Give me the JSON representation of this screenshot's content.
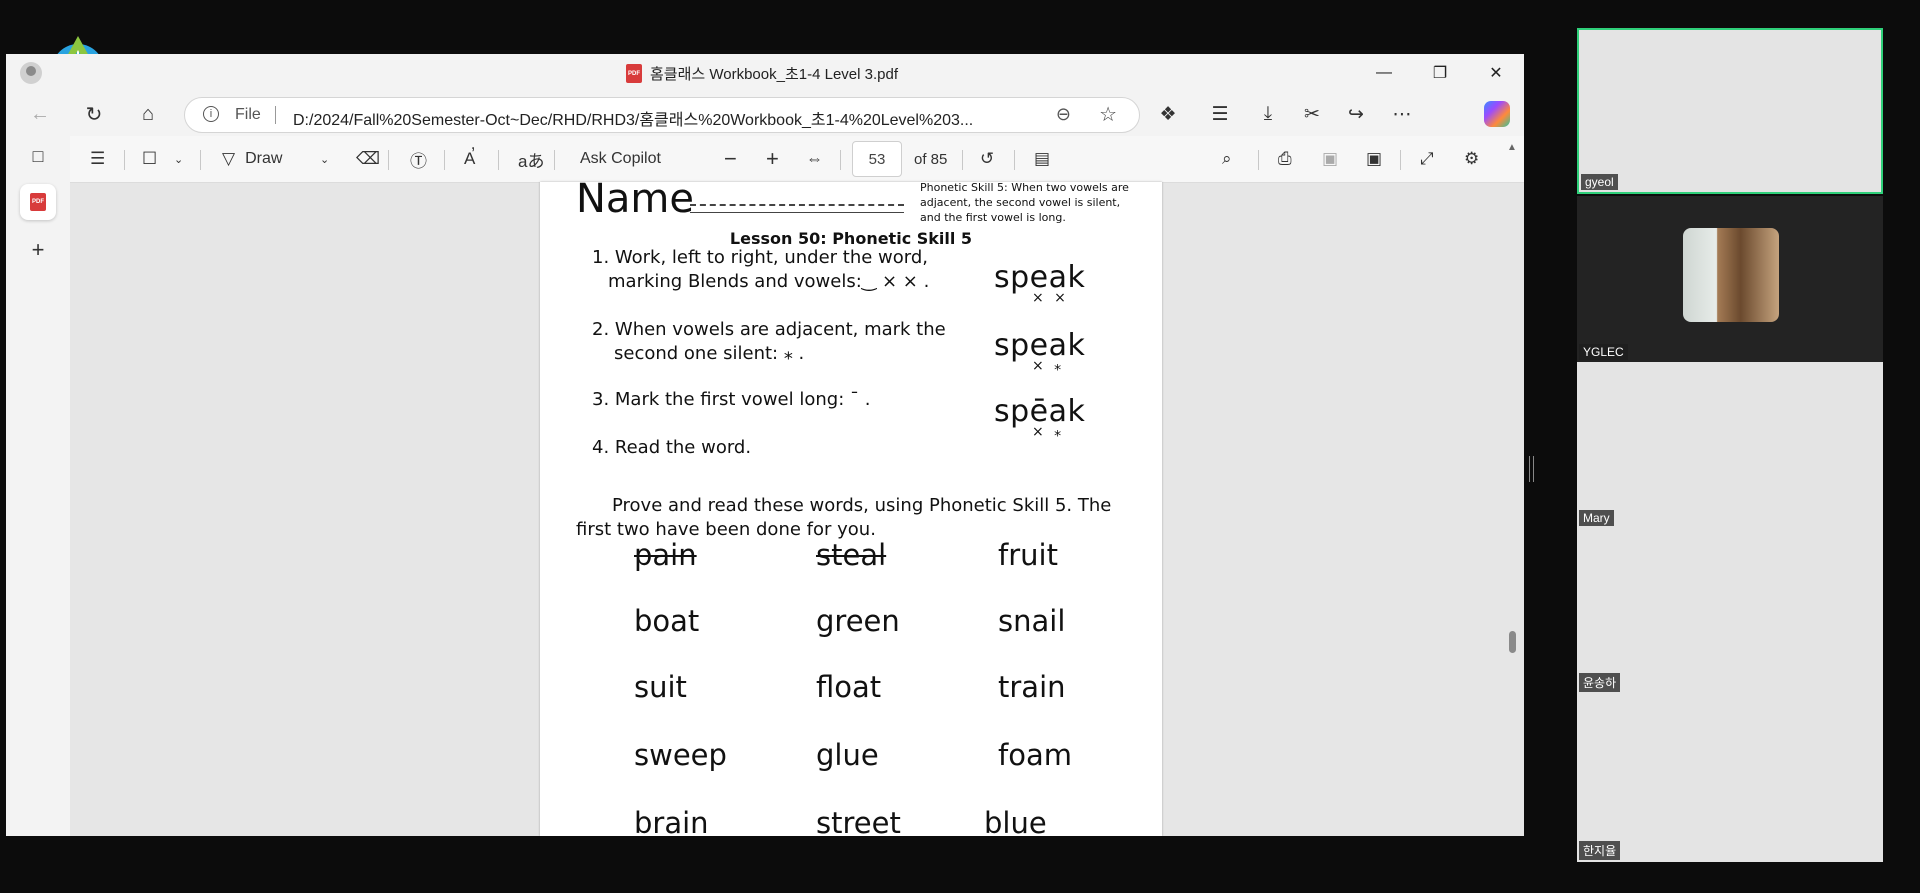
{
  "window": {
    "title": "홈클래스 Workbook_초1-4 Level 3.pdf",
    "pdf_icon_label": "PDF"
  },
  "address": {
    "scheme_label": "File",
    "url": "D:/2024/Fall%20Semester-Oct~Dec/RHD/RHD3/홈클래스%20Workbook_초1-4%20Level%203..."
  },
  "pdf_toolbar": {
    "draw_label": "Draw",
    "ask_copilot_label": "Ask Copilot",
    "page_current": "53",
    "page_total": "of 85"
  },
  "worksheet": {
    "name_label": "Name",
    "note": "Phonetic Skill 5: When two vowels are adjacent, the second vowel is silent, and the first vowel is long.",
    "lesson_title": "Lesson 50: Phonetic Skill 5",
    "steps": [
      {
        "line1": "1. Work, left to right, under the word,",
        "line2": "marking Blends and vowels:‿ × × ."
      },
      {
        "line1": "2. When vowels are adjacent, mark the",
        "line2": "second one silent: ⁎ ."
      },
      {
        "line1": "3. Mark the first vowel long: ¯ .",
        "line2": ""
      },
      {
        "line1": "4. Read the word.",
        "line2": ""
      }
    ],
    "examples": [
      "speak",
      "speak",
      "spēak"
    ],
    "example_marks": [
      "× ×",
      "× ⁎",
      "× ⁎"
    ],
    "instruction": "Prove and read these words, using Phonetic Skill 5. The first two have been done for you.",
    "words": [
      [
        "pain",
        "steal",
        "fruit"
      ],
      [
        "boat",
        "green",
        "snail"
      ],
      [
        "suit",
        "float",
        "train"
      ],
      [
        "sweep",
        "glue",
        "foam"
      ],
      [
        "brain",
        "street",
        "blue"
      ]
    ]
  },
  "participants": [
    {
      "name": "gyeol"
    },
    {
      "name": "YGLEC"
    },
    {
      "name": "Mary"
    },
    {
      "name": "윤송하"
    },
    {
      "name": "한지율"
    }
  ]
}
